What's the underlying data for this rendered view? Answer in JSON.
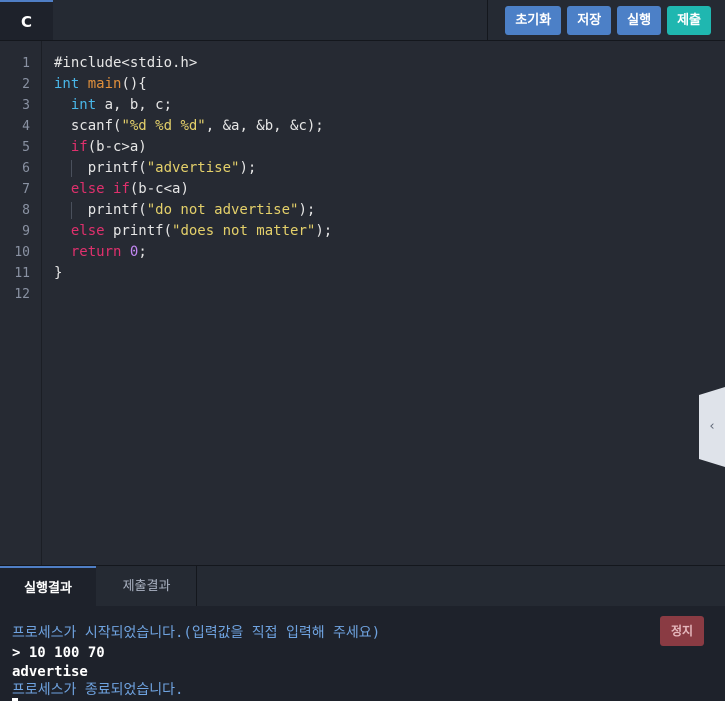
{
  "header": {
    "language_tab": "C",
    "buttons": {
      "reset": "초기화",
      "save": "저장",
      "run": "실행",
      "submit": "제출"
    }
  },
  "editor": {
    "line_numbers": [
      "1",
      "2",
      "3",
      "4",
      "5",
      "6",
      "7",
      "8",
      "9",
      "10",
      "11",
      "12"
    ]
  },
  "toggle": {
    "chevron": "‹"
  },
  "output_tabs": {
    "run_result": "실행결과",
    "submit_result": "제출결과"
  },
  "output": {
    "stop_label": "정지",
    "lines": [
      "프로세스가 시작되었습니다.(입력값을 직접 입력해 주세요)",
      "> 10 100 70",
      "advertise",
      "프로세스가 종료되었습니다."
    ]
  },
  "colors": {
    "accent": "#4c80c7",
    "submit": "#1fb7b0",
    "stop": "#8a3b43"
  },
  "icons": {
    "toggle": "chevron-left-icon"
  }
}
